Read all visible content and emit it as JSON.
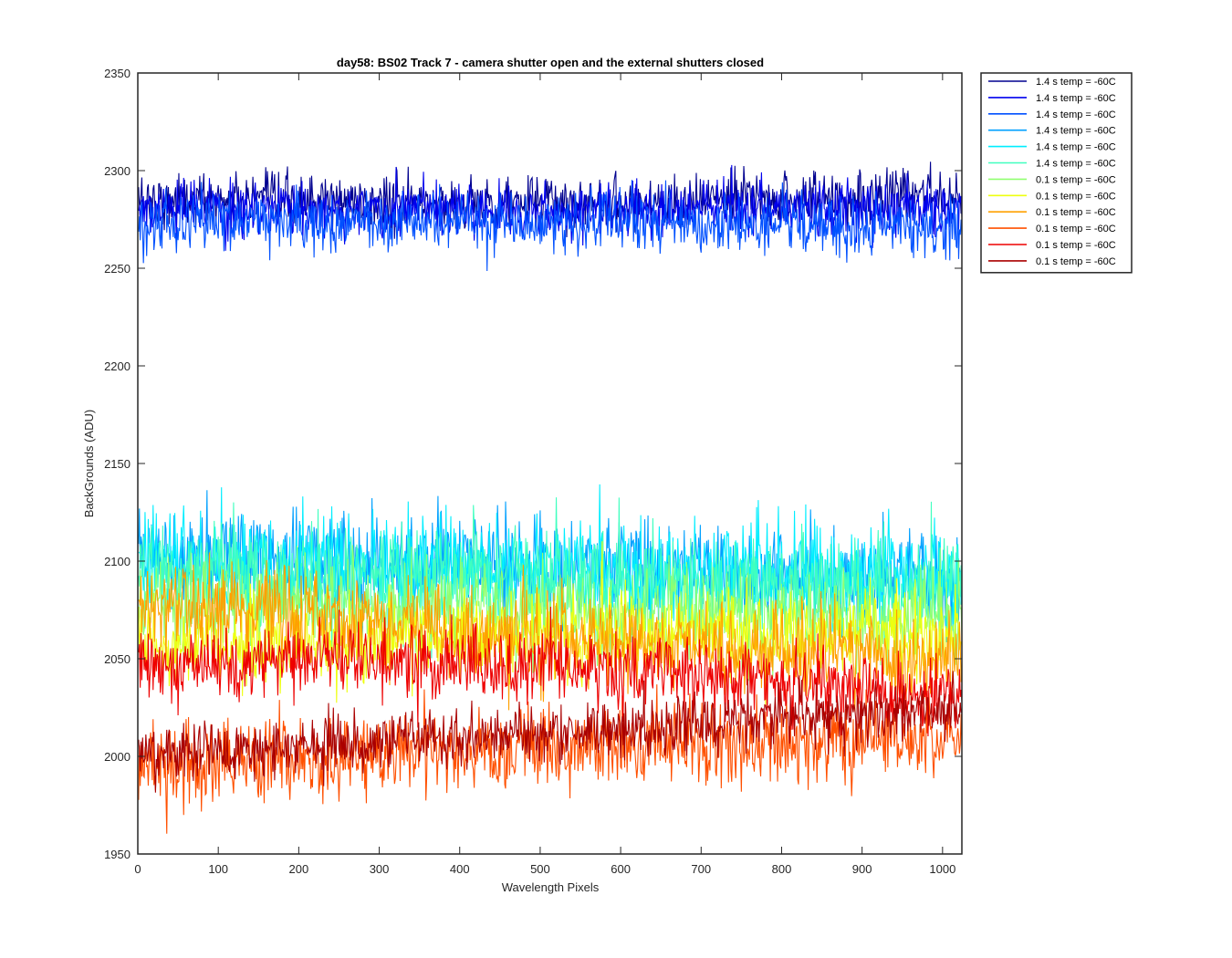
{
  "chart_data": {
    "type": "line",
    "title": "day58: BS02  Track 7 - camera shutter open and the external shutters closed",
    "xlabel": "Wavelength Pixels",
    "ylabel": "BackGrounds (ADU)",
    "xlim": [
      0,
      1024
    ],
    "ylim": [
      1950,
      2350
    ],
    "xticks": [
      0,
      100,
      200,
      300,
      400,
      500,
      600,
      700,
      800,
      900,
      1000
    ],
    "yticks": [
      1950,
      2000,
      2050,
      2100,
      2150,
      2200,
      2250,
      2300,
      2350
    ],
    "grid": false,
    "legend_position": "outside-top-right",
    "series": [
      {
        "name": "1.4 s temp = -60C",
        "color": "#00008F",
        "mean": 2283,
        "noise": 9,
        "start": 2285,
        "end": 2288
      },
      {
        "name": "1.4 s temp = -60C",
        "color": "#0000EE",
        "mean": 2280,
        "noise": 9,
        "start": 2280,
        "end": 2281
      },
      {
        "name": "1.4 s temp = -60C",
        "color": "#0050FF",
        "mean": 2274,
        "noise": 10,
        "start": 2274,
        "end": 2270
      },
      {
        "name": "1.4 s temp = -60C",
        "color": "#00A0FF",
        "mean": 2098,
        "noise": 17,
        "start": 2105,
        "end": 2090
      },
      {
        "name": "1.4 s temp = -60C",
        "color": "#00EEFF",
        "mean": 2095,
        "noise": 18,
        "start": 2100,
        "end": 2095
      },
      {
        "name": "1.4 s temp = -60C",
        "color": "#40FFBF",
        "mean": 2090,
        "noise": 17,
        "start": 2095,
        "end": 2085
      },
      {
        "name": "0.1 s temp = -60C",
        "color": "#90FF70",
        "mean": 2075,
        "noise": 15,
        "start": 2080,
        "end": 2070
      },
      {
        "name": "0.1 s temp = -60C",
        "color": "#EEFF10",
        "mean": 2063,
        "noise": 14,
        "start": 2055,
        "end": 2062
      },
      {
        "name": "0.1 s temp = -60C",
        "color": "#FFA000",
        "mean": 2060,
        "noise": 15,
        "start": 2080,
        "end": 2050
      },
      {
        "name": "0.1 s temp = -60C",
        "color": "#FF5000",
        "mean": 2005,
        "noise": 14,
        "start": 1995,
        "end": 2010
      },
      {
        "name": "0.1 s temp = -60C",
        "color": "#EE0000",
        "mean": 2048,
        "noise": 12,
        "start": 2048,
        "end": 2030
      },
      {
        "name": "0.1 s temp = -60C",
        "color": "#AA0000",
        "mean": 2012,
        "noise": 10,
        "start": 2000,
        "end": 2025
      }
    ]
  }
}
